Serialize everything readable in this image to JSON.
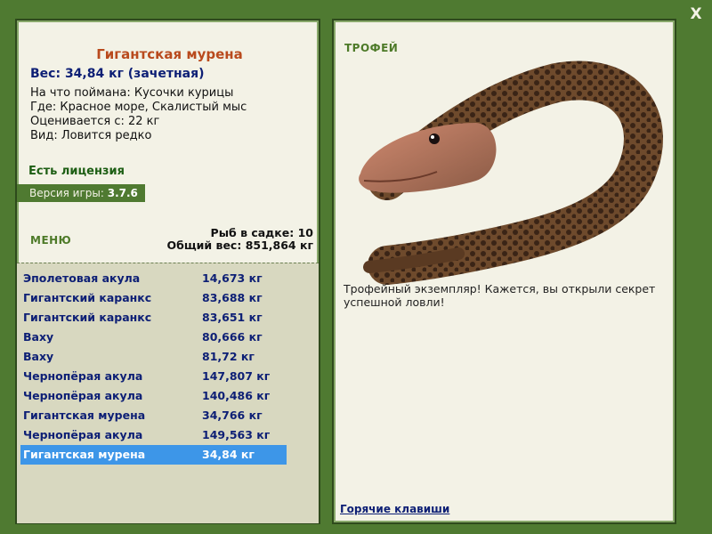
{
  "close_label": "X",
  "fish": {
    "title": "Гигантская мурена",
    "weight_line": "Вес: 34,84 кг (зачетная)",
    "caught_on": "На что поймана: Кусочки курицы",
    "location": "Где: Красное море, Скалистый мыс",
    "rated_from": "Оценивается с: 22 кг",
    "rarity": "Вид: Ловится редко"
  },
  "license_text": "Есть лицензия",
  "version": {
    "label": "Версия игры:",
    "value": "3.7.6"
  },
  "menu_label": "МЕНЮ",
  "keepnet": {
    "count_text": "Рыб в садке: 10",
    "total_text": "Общий вес: 851,864 кг"
  },
  "catches": [
    {
      "name": "Эполетовая акула",
      "weight": "14,673 кг"
    },
    {
      "name": "Гигантский каранкс",
      "weight": "83,688 кг"
    },
    {
      "name": "Гигантский каранкс",
      "weight": "83,651 кг"
    },
    {
      "name": "Ваху",
      "weight": "80,666 кг"
    },
    {
      "name": "Ваху",
      "weight": "81,72 кг"
    },
    {
      "name": "Чернопёрая акула",
      "weight": "147,807 кг"
    },
    {
      "name": "Чернопёрая акула",
      "weight": "140,486 кг"
    },
    {
      "name": "Гигантская мурена",
      "weight": "34,766 кг"
    },
    {
      "name": "Чернопёрая акула",
      "weight": "149,563 кг"
    },
    {
      "name": "Гигантская мурена",
      "weight": "34,84 кг"
    }
  ],
  "selected_index": 9,
  "trophy": {
    "label": "ТРОФЕЙ",
    "text": "Трофейный экземпляр! Кажется, вы открыли секрет успешной ловли!"
  },
  "hotkeys_link": "Горячие клавиши",
  "colors": {
    "frame_green": "#4f7a31",
    "panel_bg": "#f3f2e6",
    "list_bg": "#d8d8c0",
    "selection_blue": "#3d96e8",
    "title_orange": "#b94a1d",
    "text_navy": "#0d1f75"
  }
}
